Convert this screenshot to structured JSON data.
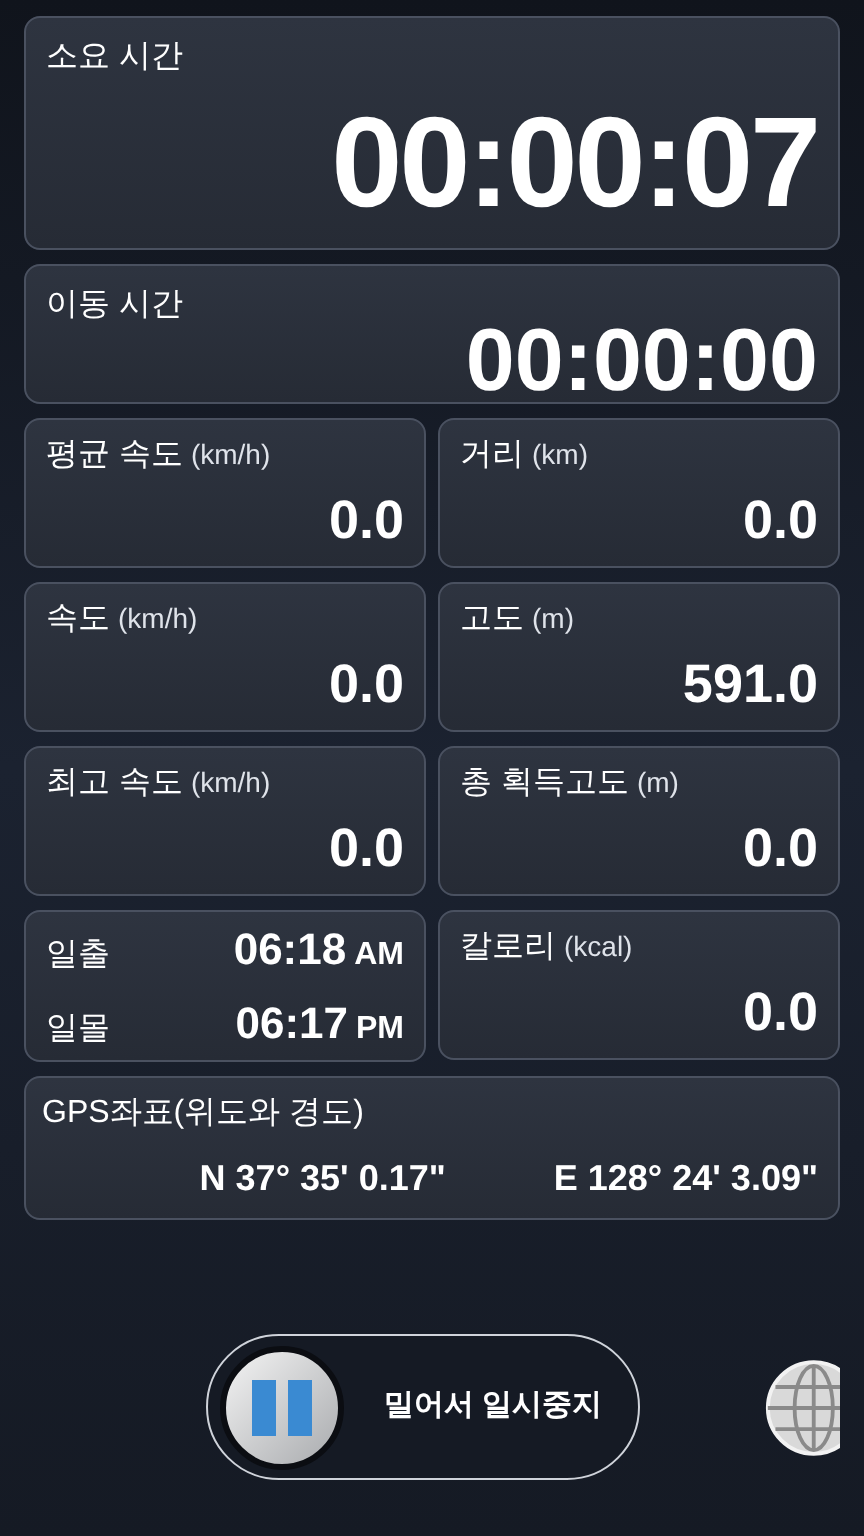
{
  "elapsed_time": {
    "label": "소요 시간",
    "value": "00:00:07"
  },
  "moving_time": {
    "label": "이동 시간",
    "value": "00:00:00"
  },
  "stats": [
    {
      "label": "평균 속도",
      "unit": "(km/h)",
      "value": "0.0"
    },
    {
      "label": "거리",
      "unit": "(km)",
      "value": "0.0"
    },
    {
      "label": "속도",
      "unit": "(km/h)",
      "value": "0.0"
    },
    {
      "label": "고도",
      "unit": "(m)",
      "value": "591.0"
    },
    {
      "label": "최고 속도",
      "unit": "(km/h)",
      "value": "0.0"
    },
    {
      "label": "총 획득고도",
      "unit": "(m)",
      "value": "0.0"
    }
  ],
  "sun": [
    {
      "label": "일출",
      "time": "06:18",
      "period": "AM"
    },
    {
      "label": "일몰",
      "time": "06:17",
      "period": "PM"
    }
  ],
  "calories": {
    "label": "칼로리",
    "unit": "(kcal)",
    "value": "0.0"
  },
  "gps": {
    "label": "GPS좌표(위도와 경도)",
    "latitude": "N 37° 35' 0.17\"",
    "longitude": "E 128° 24' 3.09\""
  },
  "slider": {
    "label": "밀어서 일시중지",
    "level": 0
  }
}
